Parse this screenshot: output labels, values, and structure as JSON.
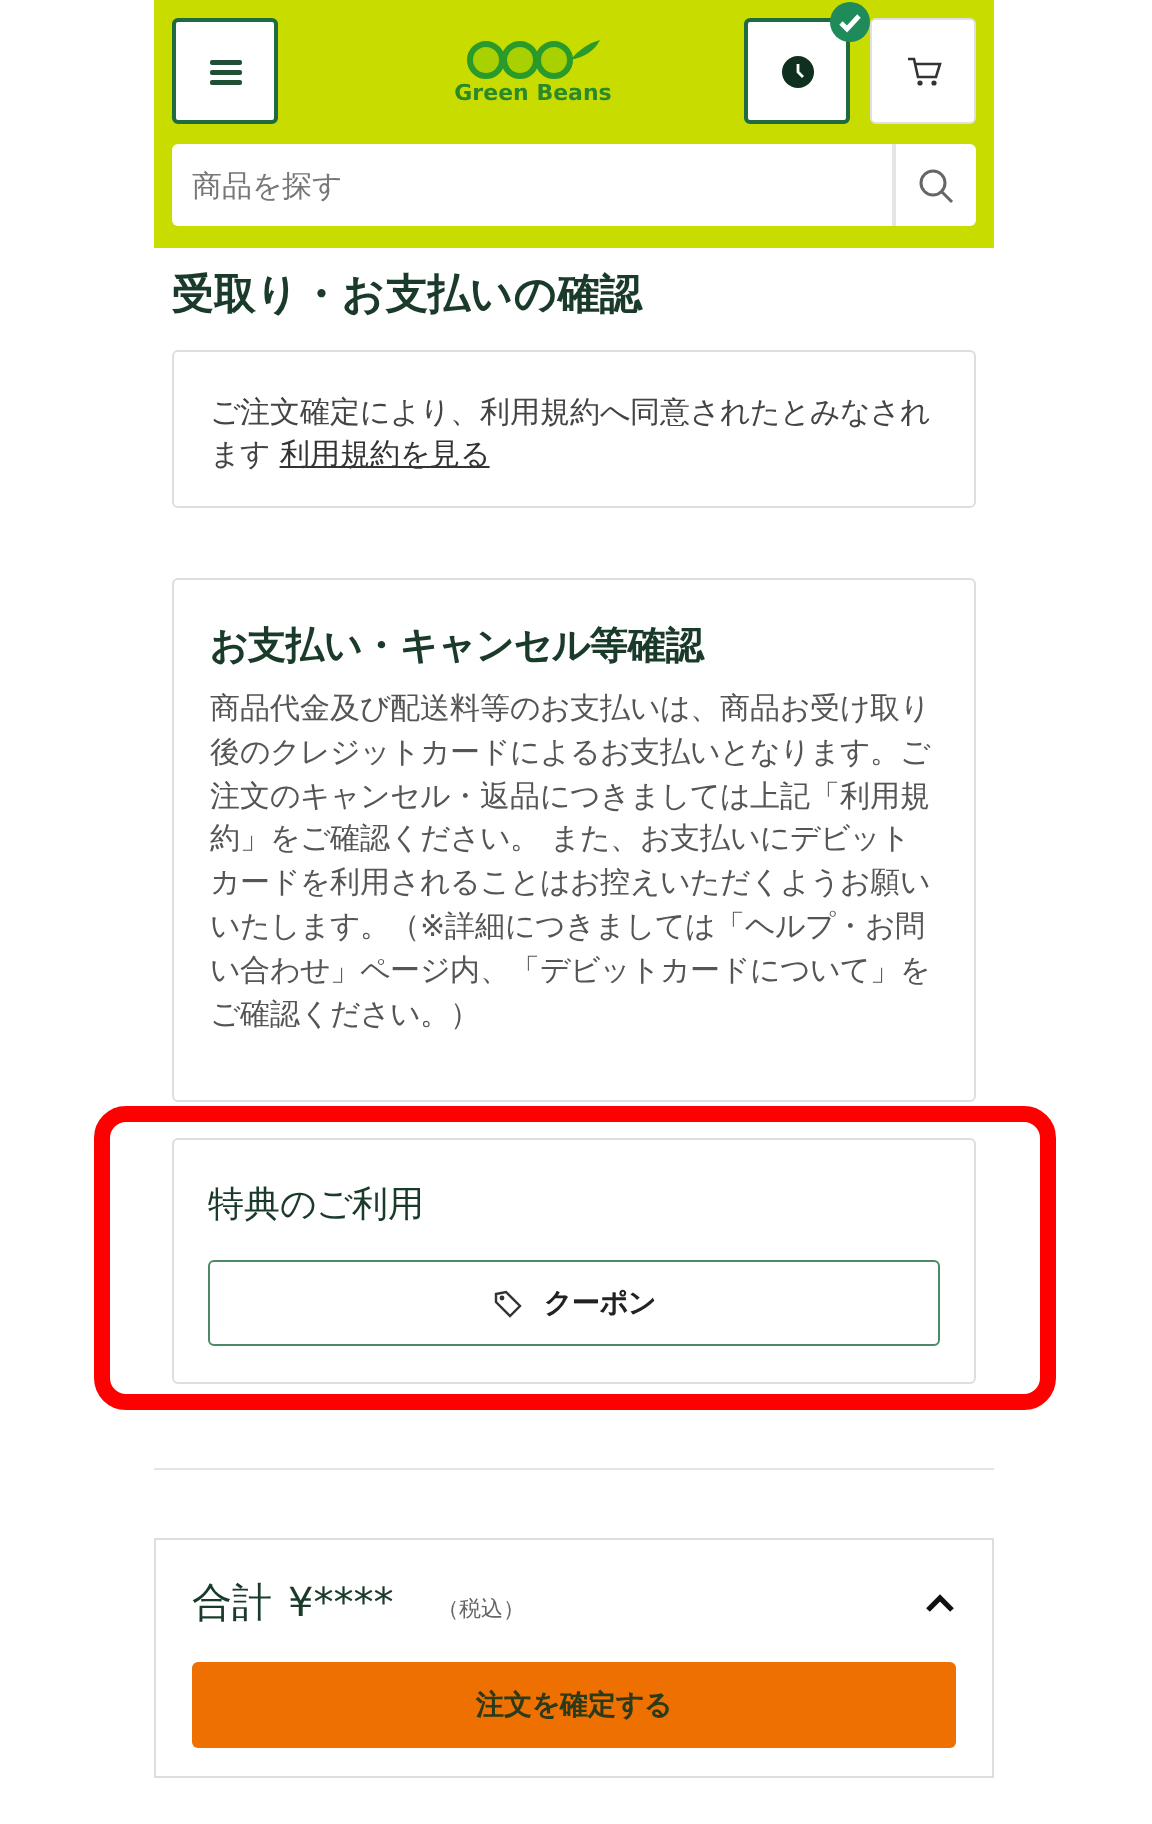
{
  "header": {
    "logo": "Green Beans",
    "history_badge": true,
    "search": {
      "placeholder": "商品を探す"
    }
  },
  "page_title": "受取り・お支払いの確認",
  "terms_notice": {
    "text": "ご注文確定により、利用規約へ同意されたとみなされます",
    "link": "利用規約を見る"
  },
  "payment_section": {
    "title": "お支払い・キャンセル等確認",
    "body": "商品代金及び配送料等のお支払いは、商品お受け取り後のクレジットカードによるお支払いとなります。ご注文のキャンセル・返品につきましては上記「利用規約」をご確認ください。 また、お支払いにデビットカードを利用されることはお控えいただくようお願いいたします。（※詳細につきましては「ヘルプ・お問い合わせ」ページ内、「デビットカードについて」をご確認ください。）"
  },
  "benefits_section": {
    "title": "特典のご利用",
    "highlighted": true,
    "coupon_button": "クーポン"
  },
  "total": {
    "label": "合計",
    "amount": "¥****",
    "tax_note": "（税込）",
    "expanded": true,
    "confirm_button": "注文を確定する"
  }
}
